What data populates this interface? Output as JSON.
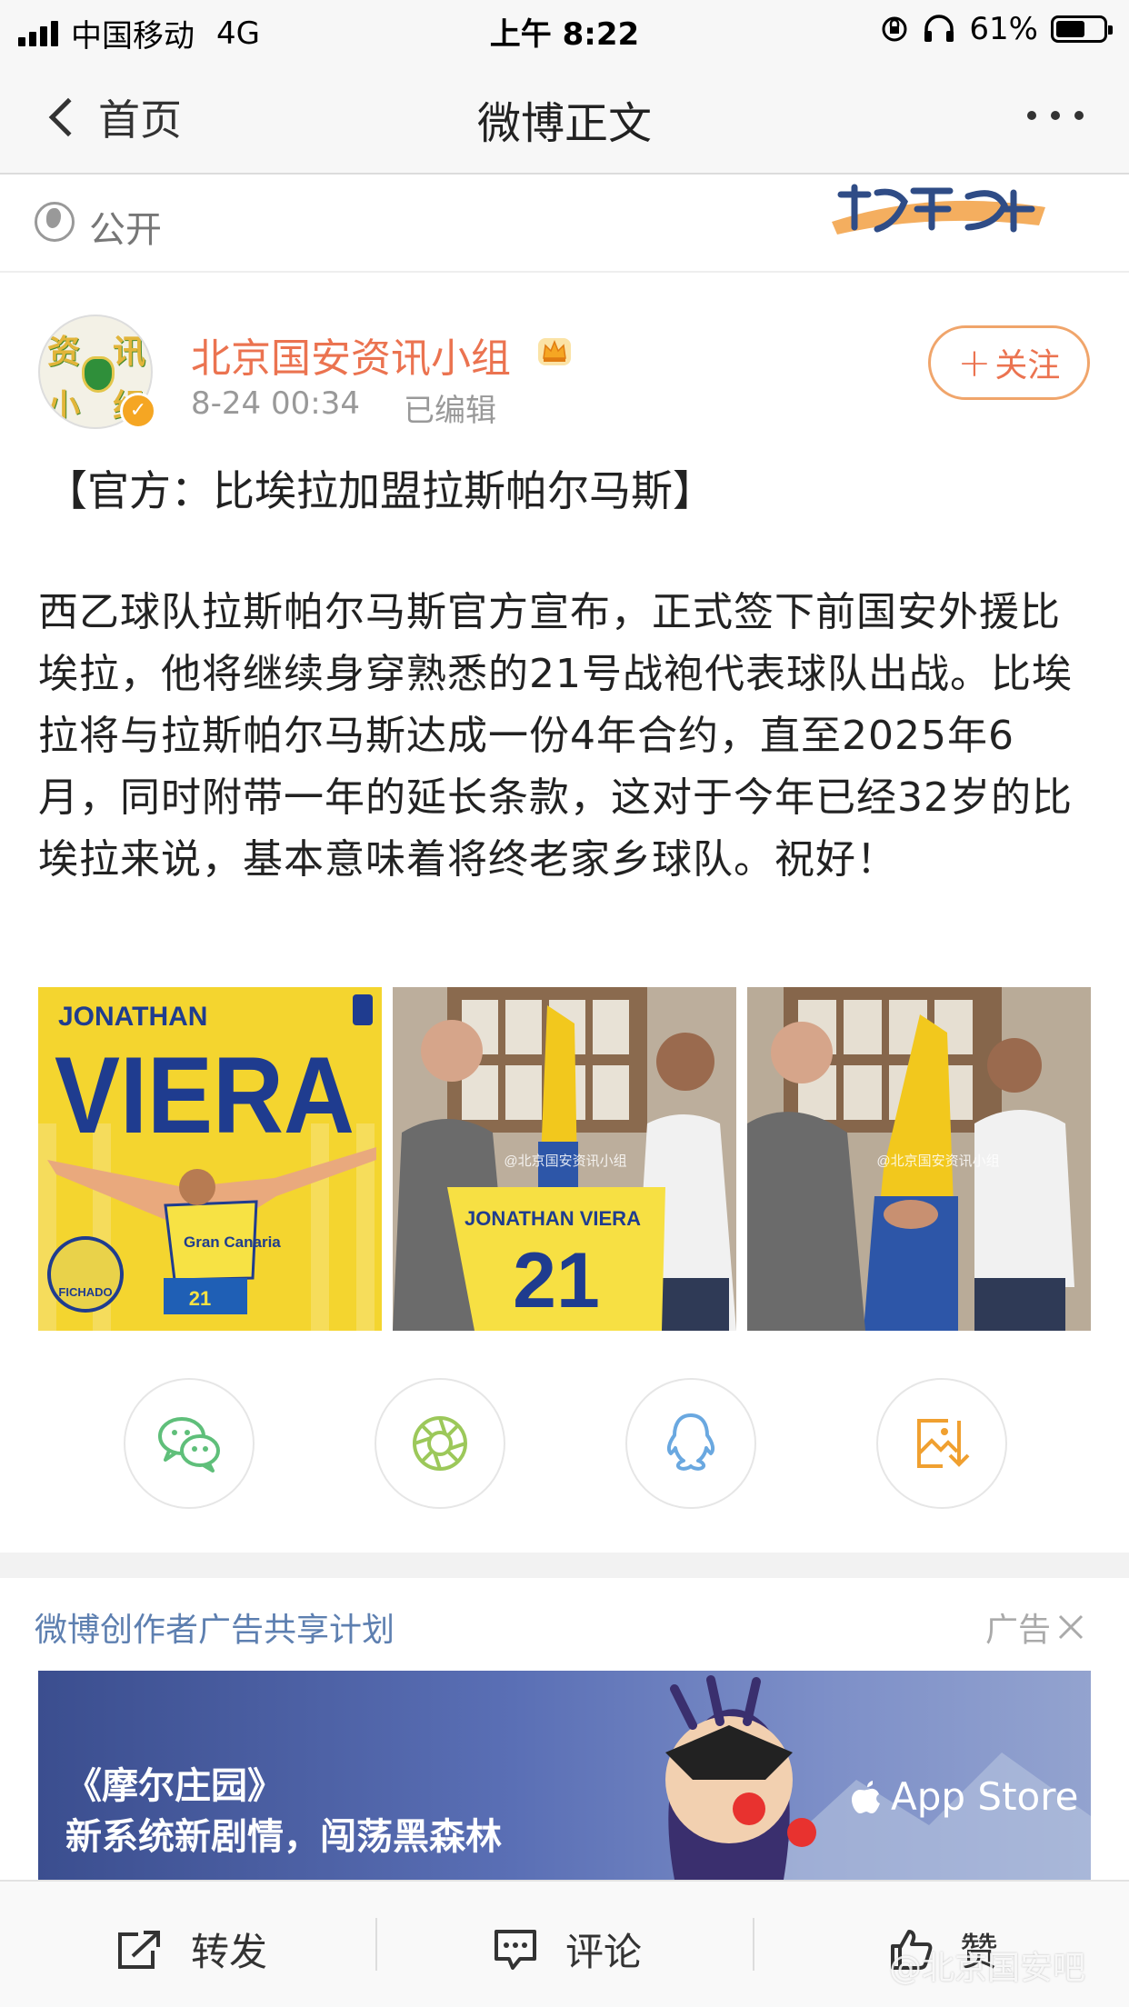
{
  "status_bar": {
    "carrier": "中国移动",
    "network": "4G",
    "time": "上午 8:22",
    "battery": "61%",
    "battery_level": 0.61
  },
  "nav": {
    "back_label": "首页",
    "title": "微博正文"
  },
  "visibility": {
    "label": "公开",
    "icon": "globe-icon"
  },
  "author": {
    "name": "北京国安资讯小组",
    "avatar_text": [
      "资",
      "讯",
      "小",
      "组"
    ],
    "time": "8-24 00:34",
    "edited": "已编辑",
    "follow_label": "关注",
    "follow_plus": "+"
  },
  "post": {
    "headline": "【官方：比埃拉加盟拉斯帕尔马斯】",
    "body": "西乙球队拉斯帕尔马斯官方宣布，正式签下前国安外援比埃拉，他将继续身穿熟悉的21号战袍代表球队出战。比埃拉将与拉斯帕尔马斯达成一份4年合约，直至2025年6月，同时附带一年的延长条款，这对于今年已经32岁的比埃拉来说，基本意味着将终老家乡球队。祝好！",
    "images": [
      {
        "first_name": "JONATHAN",
        "last_name": "VIERA",
        "stamp": "FICHADO",
        "sponsor": "Gran Canaria",
        "number": "21"
      },
      {
        "jersey_name": "JONATHAN VIERA",
        "jersey_number": "21",
        "watermark": "@北京国安资讯小组"
      },
      {
        "watermark": "@北京国安资讯小组"
      }
    ]
  },
  "share": [
    {
      "icon": "wechat-icon",
      "color": "#5fbf7a"
    },
    {
      "icon": "moments-icon",
      "color": "#9cc85a"
    },
    {
      "icon": "qq-icon",
      "color": "#6aa8e0"
    },
    {
      "icon": "save-image-icon",
      "color": "#f0a030"
    }
  ],
  "ad": {
    "plan": "微博创作者广告共享计划",
    "tag": "广告",
    "game": "《摩尔庄园》",
    "slogan": "新系统新剧情，闯荡黑森林",
    "store": "App Store"
  },
  "toolbar": {
    "repost": "转发",
    "comment": "评论",
    "like": "赞",
    "watermark": "@北京国安吧"
  },
  "colors": {
    "accent": "#eb7350",
    "link_blue": "#5d7fb0",
    "vip_orange": "#f5a623"
  }
}
